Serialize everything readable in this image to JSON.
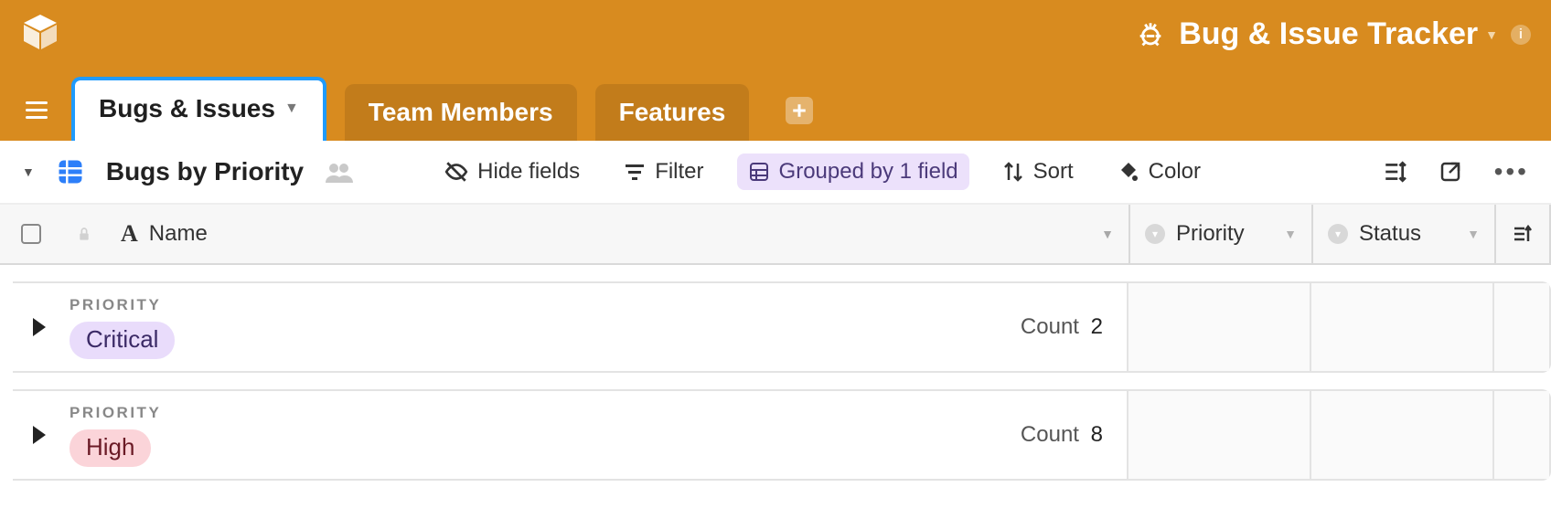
{
  "workspace": {
    "title": "Bug & Issue Tracker"
  },
  "tabs": {
    "items": [
      {
        "label": "Bugs & Issues",
        "active": true
      },
      {
        "label": "Team Members",
        "active": false
      },
      {
        "label": "Features",
        "active": false
      }
    ]
  },
  "toolbar": {
    "view_name": "Bugs by Priority",
    "hide_fields": "Hide fields",
    "filter": "Filter",
    "grouped": "Grouped by 1 field",
    "sort": "Sort",
    "color": "Color"
  },
  "columns": {
    "name": "Name",
    "priority": "Priority",
    "status": "Status"
  },
  "groups": {
    "label": "PRIORITY",
    "count_label": "Count",
    "items": [
      {
        "value": "Critical",
        "chip_class": "chip-critical",
        "count": 2
      },
      {
        "value": "High",
        "chip_class": "chip-high",
        "count": 8
      }
    ]
  },
  "colors": {
    "brand": "#d88b1f",
    "accent_blue": "#1f9bff",
    "pill_bg": "#ece1fb"
  }
}
